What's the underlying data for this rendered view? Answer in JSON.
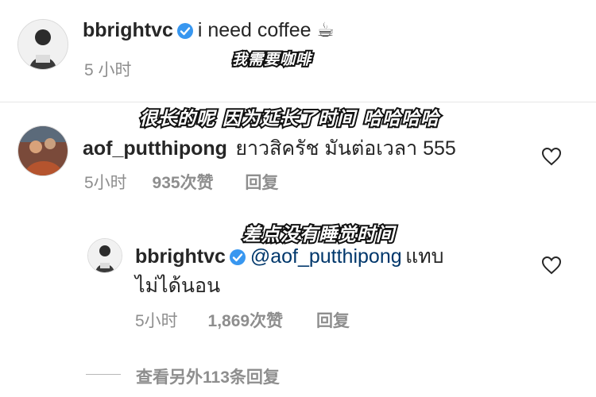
{
  "colors": {
    "text": "#262626",
    "secondary": "#8e8e8e",
    "mention": "#00376b",
    "verified": "#3897f0",
    "overlay_text": "#ffffff",
    "overlay_outline": "#111111"
  },
  "caption": {
    "username": "bbrightvc",
    "text": "i need coffee ☕",
    "time": "5 小时",
    "overlay": "我需要咖啡"
  },
  "comment1": {
    "username": "aof_putthipong",
    "text": "ยาวสิครัช มันต่อเวลา 555",
    "time": "5小时",
    "likes": "935次赞",
    "reply": "回复",
    "overlay": "很长的呢 因为延长了时间 哈哈哈哈"
  },
  "reply1": {
    "username": "bbrightvc",
    "mention": "@aof_putthipong",
    "text_line1": "แทบ",
    "text_line2": "ไม่ได้นอน",
    "time": "5小时",
    "likes": "1,869次赞",
    "reply": "回复",
    "overlay": "差点没有睡觉时间"
  },
  "more_replies": {
    "label": "查看另外113条回复"
  }
}
